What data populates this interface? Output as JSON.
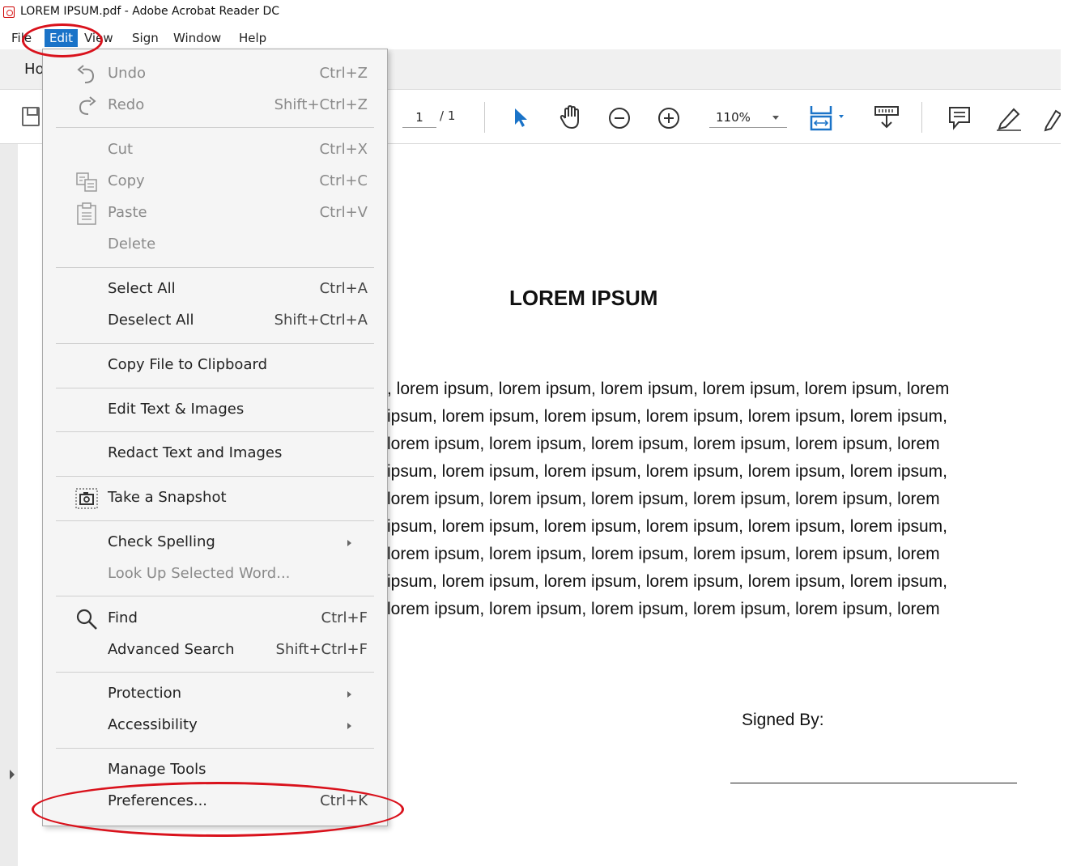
{
  "window": {
    "title": "LOREM IPSUM.pdf - Adobe Acrobat Reader DC"
  },
  "menubar": {
    "file": "File",
    "edit": "Edit",
    "view": "View",
    "sign": "Sign",
    "window": "Window",
    "help": "Help"
  },
  "tabbar": {
    "home": "Ho"
  },
  "toolbar": {
    "page_current": "1",
    "page_total": "/ 1",
    "zoom": "110%"
  },
  "edit_menu": {
    "undo": {
      "label": "Undo",
      "shortcut": "Ctrl+Z"
    },
    "redo": {
      "label": "Redo",
      "shortcut": "Shift+Ctrl+Z"
    },
    "cut": {
      "label": "Cut",
      "shortcut": "Ctrl+X"
    },
    "copy": {
      "label": "Copy",
      "shortcut": "Ctrl+C"
    },
    "paste": {
      "label": "Paste",
      "shortcut": "Ctrl+V"
    },
    "delete": {
      "label": "Delete"
    },
    "select_all": {
      "label": "Select All",
      "shortcut": "Ctrl+A"
    },
    "deselect_all": {
      "label": "Deselect All",
      "shortcut": "Shift+Ctrl+A"
    },
    "copy_file": {
      "label": "Copy File to Clipboard"
    },
    "edit_text": {
      "label": "Edit Text & Images"
    },
    "redact": {
      "label": "Redact Text and Images"
    },
    "snapshot": {
      "label": "Take a Snapshot"
    },
    "spelling": {
      "label": "Check Spelling"
    },
    "lookup": {
      "label": "Look Up Selected Word..."
    },
    "find": {
      "label": "Find",
      "shortcut": "Ctrl+F"
    },
    "adv_search": {
      "label": "Advanced Search",
      "shortcut": "Shift+Ctrl+F"
    },
    "protection": {
      "label": "Protection"
    },
    "accessibility": {
      "label": "Accessibility"
    },
    "manage_tools": {
      "label": "Manage Tools"
    },
    "preferences": {
      "label": "Preferences...",
      "shortcut": "Ctrl+K"
    }
  },
  "document": {
    "title": "LOREM IPSUM",
    "lines": [
      ", lorem ipsum, lorem ipsum, lorem ipsum, lorem ipsum, lorem ipsum, lorem",
      "ipsum, lorem ipsum, lorem ipsum, lorem ipsum, lorem ipsum, lorem ipsum,",
      " lorem ipsum, lorem ipsum, lorem ipsum, lorem ipsum, lorem ipsum, lorem",
      "ipsum, lorem ipsum, lorem ipsum, lorem ipsum, lorem ipsum, lorem ipsum,",
      " lorem ipsum, lorem ipsum, lorem ipsum, lorem ipsum, lorem ipsum, lorem",
      "ipsum, lorem ipsum, lorem ipsum, lorem ipsum, lorem ipsum, lorem ipsum,",
      " lorem ipsum, lorem ipsum, lorem ipsum, lorem ipsum, lorem ipsum, lorem",
      "ipsum, lorem ipsum, lorem ipsum, lorem ipsum, lorem ipsum, lorem ipsum,",
      " lorem ipsum, lorem ipsum, lorem ipsum, lorem ipsum, lorem ipsum, lorem"
    ],
    "signed_label": "Signed By:"
  },
  "colors": {
    "menu_active": "#1a73c8",
    "annotation": "#d9121c",
    "tool_blue": "#1a73c8"
  }
}
